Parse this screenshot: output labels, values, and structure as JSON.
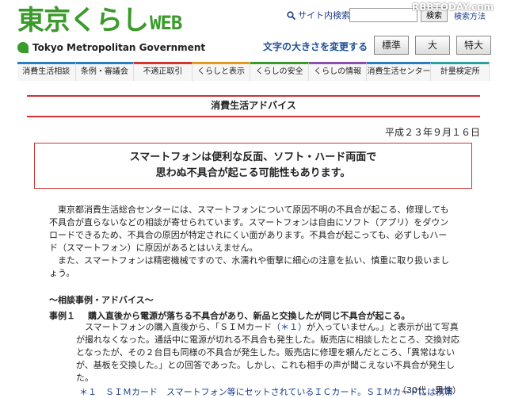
{
  "header": {
    "logo_text": "東京くらし",
    "logo_web": "WEB",
    "logo_sub": "Tokyo Metropolitan Government",
    "search_label": "サイト内検索",
    "search_button": "検索",
    "search_options": "検索方法",
    "watermark": "RBBTODAY.com",
    "fontsize_label": "文字の大きさを変更する",
    "fontsize_buttons": [
      "標準",
      "大",
      "特大"
    ]
  },
  "nav": {
    "items": [
      "消費生活相談",
      "条例・審議会",
      "不適正取引",
      "くらしと表示",
      "くらしの安全",
      "くらしの情報",
      "消費生活センター",
      "計量検定所"
    ],
    "colors": [
      "#2a7fc4",
      "#2a7fc4",
      "#d0392b",
      "#e59a1f",
      "#3a9a2a",
      "#8a4fb0",
      "#2a7fc4",
      "#2aa0a0"
    ]
  },
  "article": {
    "title": "消費生活アドバイス",
    "date": "平成２３年９月１６日",
    "headline_1": "スマートフォンは便利な反面、ソフト・ハード両面で",
    "headline_2": "思わぬ不具合が起こる可能性もあります。",
    "intro_1": "東京都消費生活総合センターには、スマートフォンについて原因不明の不具合が起こる、修理しても不具合が直らないなどの相談が寄せられています。スマートフォンは自由にソフト（アプリ）をダウンロードできるため、不具合の原因が特定されにくい面があります。不具合が起こっても、必ずしもハード（スマートフォン）に原因があるとはいえません。",
    "intro_2": "また、スマートフォンは精密機械ですので、水濡れや衝撃に細心の注意を払い、慎重に取り扱いましょう。",
    "section_heading": "〜相談事例・アドバイス〜",
    "case_number": "事例１",
    "case_title": "購入直後から電源が落ちる不具合があり、新品と交換したが同じ不具合が起こる。",
    "case_body_a": "スマートフォンの購入直後から、「ＳＩＭカード",
    "case_body_note": "（＊１）",
    "case_body_b": "が入っていません。」と表示が出て写真が撮れなくなった。通話中に電源が切れる不具合も発生した。販売店に相談したところ、交換対応となったが、その２台目も同様の不具合が発生した。販売店に修理を頼んだところ、「異常はないが、基板を交換した。」との回答であった。しかし、これも相手の声が聞こえない不具合が発生した。",
    "case_person": "（30代　男性）",
    "footnote": "＊１　ＳＩＭカード　スマートフォン等にセットされているＩＣカード。ＳＩＭカードには携帯"
  }
}
